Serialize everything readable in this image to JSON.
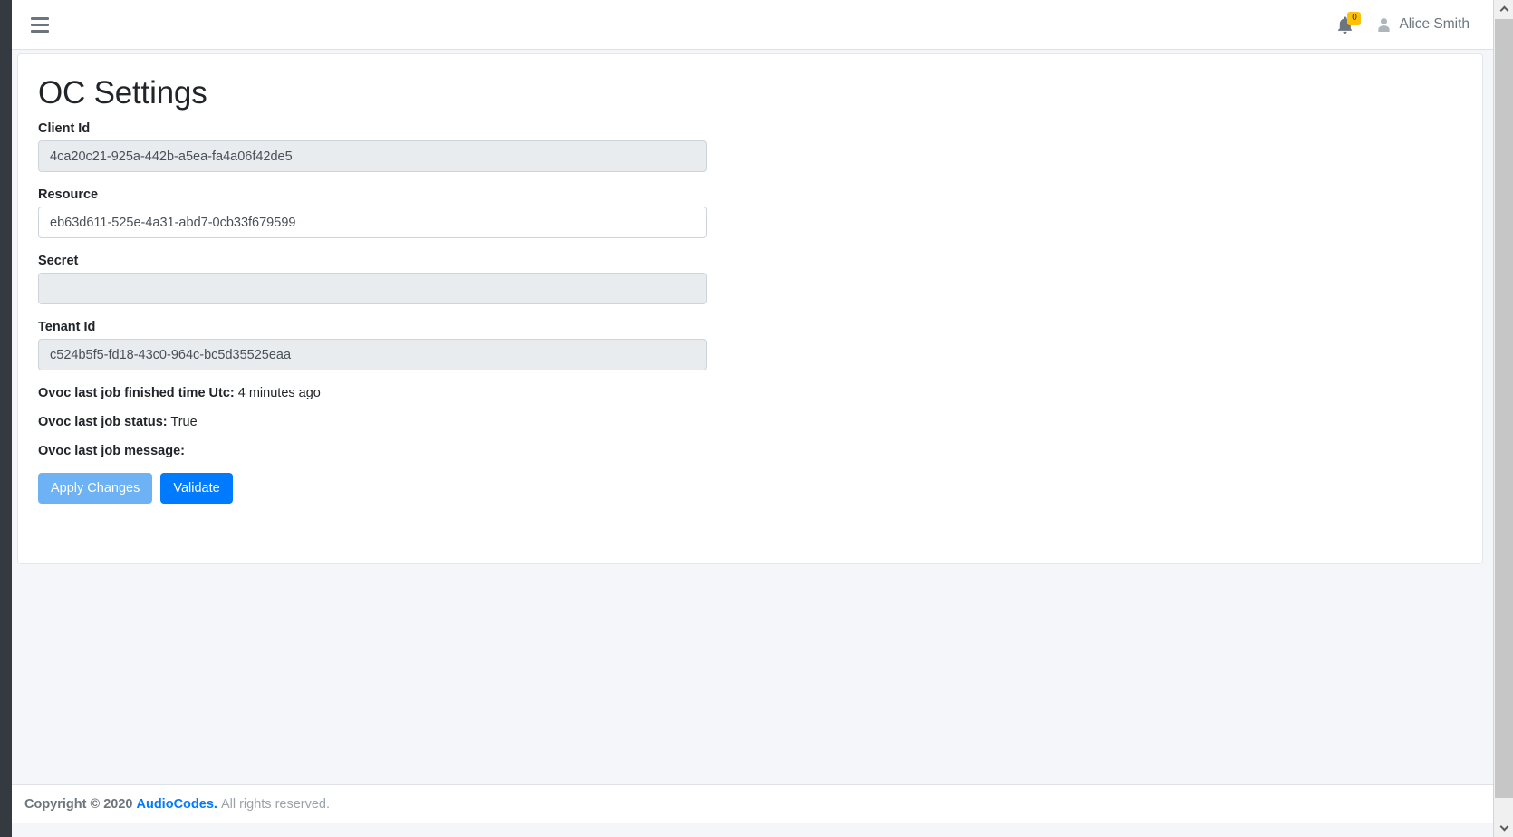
{
  "navbar": {
    "menu_toggle_label": "hamburger-menu",
    "notifications": {
      "icon": "bell-icon",
      "count": "0",
      "badge_color": "#ffc107"
    },
    "user": {
      "icon": "user-avatar-icon",
      "name": "Alice Smith"
    }
  },
  "page": {
    "title": "OC Settings"
  },
  "form": {
    "fields": [
      {
        "label": "Client Id",
        "value": "4ca20c21-925a-442b-a5ea-fa4a06f42de5",
        "placeholder": "",
        "readonly": true
      },
      {
        "label": "Resource",
        "value": "eb63d611-525e-4a31-abd7-0cb33f679599",
        "placeholder": "",
        "readonly": false
      },
      {
        "label": "Secret",
        "value": "",
        "placeholder": "",
        "readonly": true
      },
      {
        "label": "Tenant Id",
        "value": "c524b5f5-fd18-43c0-964c-bc5d35525eaa",
        "placeholder": "",
        "readonly": true
      }
    ],
    "status": [
      {
        "label": "Ovoc last job finished time Utc:",
        "value": "4 minutes ago"
      },
      {
        "label": "Ovoc last job status:",
        "value": "True"
      },
      {
        "label": "Ovoc last job message:",
        "value": ""
      }
    ],
    "buttons": {
      "apply": "Apply Changes",
      "validate": "Validate",
      "apply_color": "#6cb2f5",
      "validate_color": "#007bff"
    }
  },
  "footer": {
    "copyright": "Copyright © 2020",
    "brand": "AudioCodes.",
    "rights": "All rights reserved."
  },
  "scrollbar": {
    "up_icon": "chevron-up-icon",
    "down_icon": "chevron-down-icon"
  }
}
